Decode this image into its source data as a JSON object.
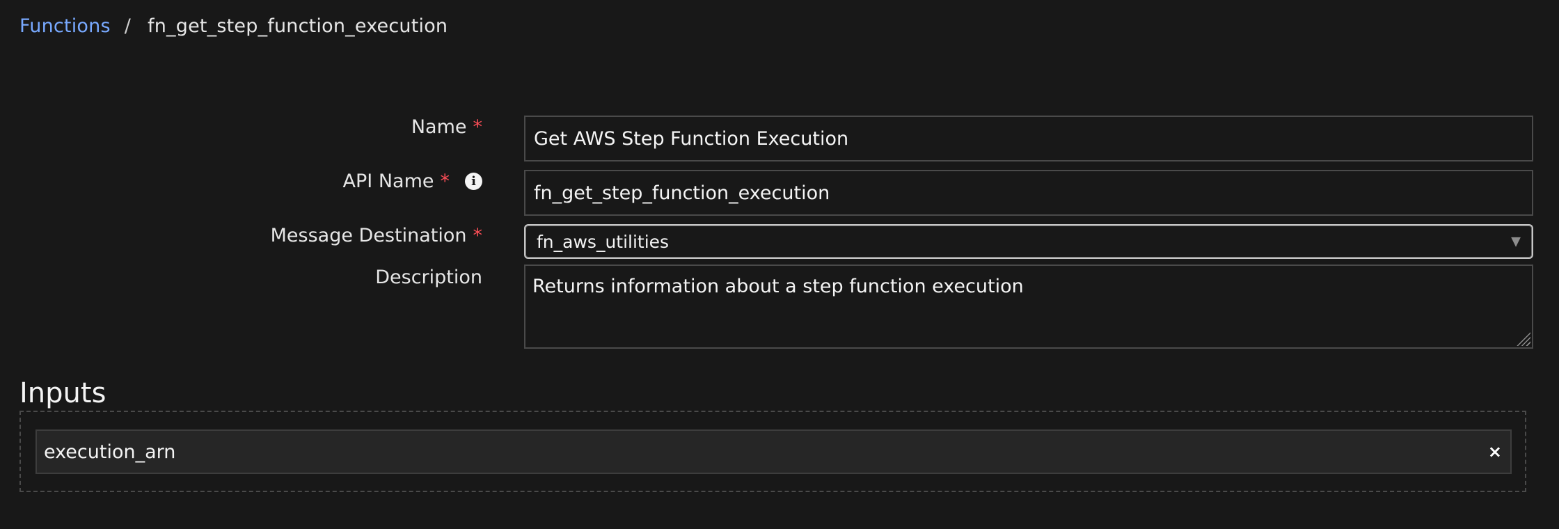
{
  "breadcrumb": {
    "parent": "Functions",
    "separator": "/",
    "current": "fn_get_step_function_execution"
  },
  "form": {
    "name": {
      "label": "Name",
      "required_mark": "*",
      "value": "Get AWS Step Function Execution"
    },
    "api_name": {
      "label": "API Name",
      "required_mark": "*",
      "info_icon": "i",
      "value": "fn_get_step_function_execution"
    },
    "message_destination": {
      "label": "Message Destination",
      "required_mark": "*",
      "value": "fn_aws_utilities",
      "arrow": "▼"
    },
    "description": {
      "label": "Description",
      "value": "Returns information about a step function execution"
    }
  },
  "inputs": {
    "title": "Inputs",
    "items": [
      {
        "label": "execution_arn",
        "remove_glyph": "×"
      }
    ]
  }
}
